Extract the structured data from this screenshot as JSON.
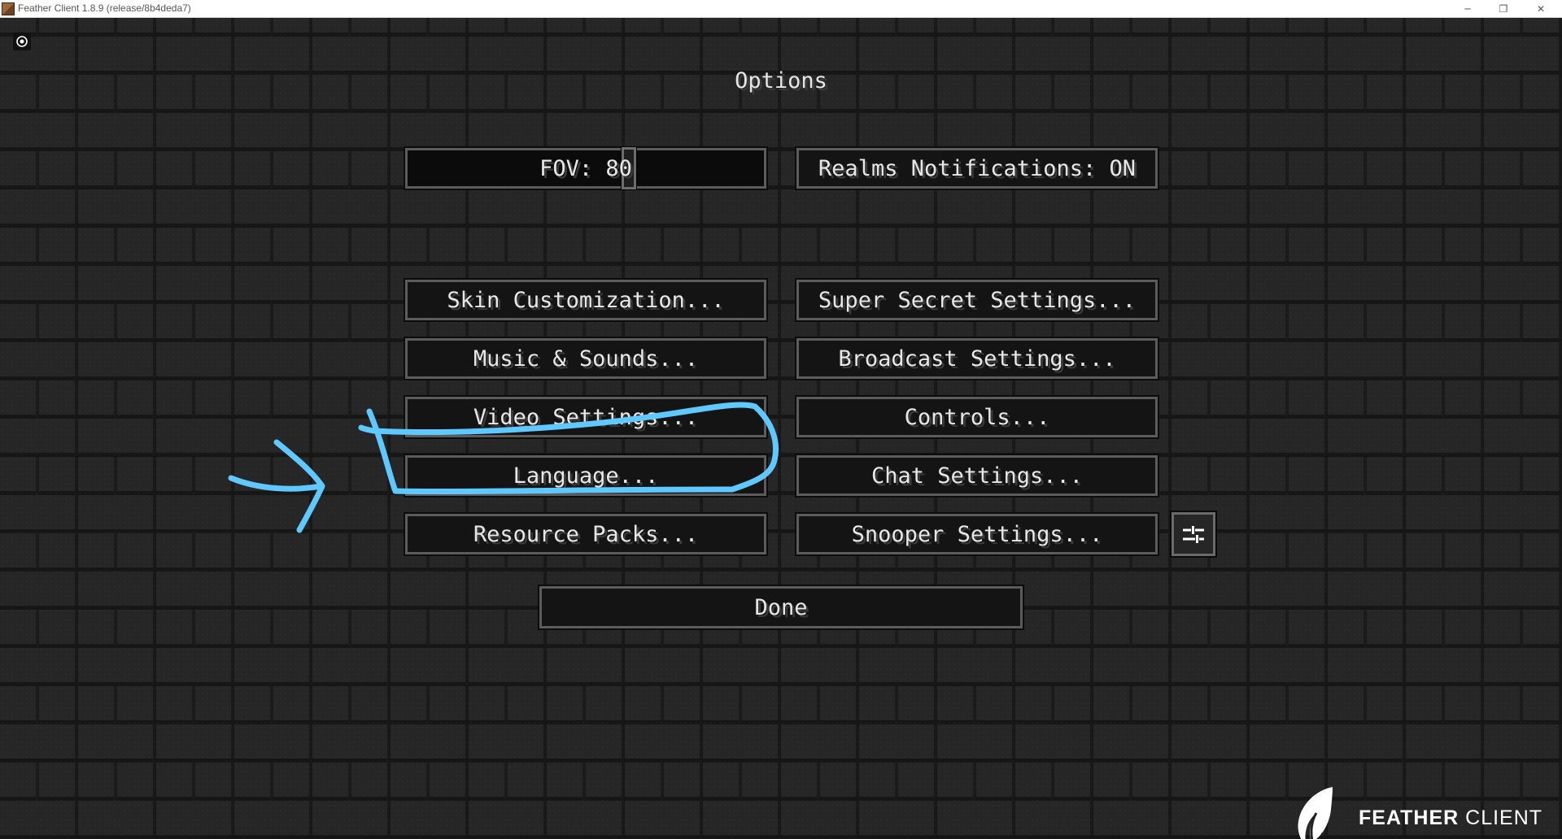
{
  "window": {
    "title": "Feather Client 1.8.9 (release/8b4deda7)",
    "controls": [
      "─",
      "❐",
      "✕"
    ]
  },
  "screen": {
    "title": "Options"
  },
  "fov": {
    "label": "FOV: 80",
    "value": 80
  },
  "buttons": {
    "realms": "Realms Notifications: ON",
    "skin": "Skin Customization...",
    "super_secret": "Super Secret Settings...",
    "music": "Music & Sounds...",
    "broadcast": "Broadcast Settings...",
    "video": "Video Settings...",
    "controls": "Controls...",
    "language": "Language...",
    "chat": "Chat Settings...",
    "resource_packs": "Resource Packs...",
    "snooper": "Snooper Settings...",
    "done": "Done"
  },
  "icons": {
    "record": "record-icon",
    "extra": "sliders-icon",
    "brand": "feather-logo-icon"
  },
  "brand": {
    "bold": "FEATHER",
    "light": "CLIENT"
  },
  "annotation": {
    "color": "#5ec8ff",
    "highlighted_option": "Language..."
  }
}
